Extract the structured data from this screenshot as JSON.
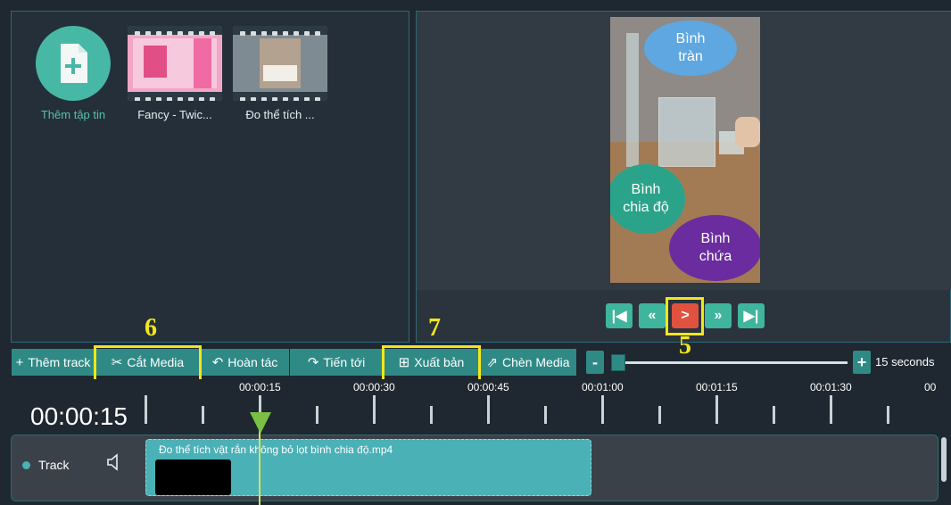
{
  "media": {
    "add_label": "Thêm tập tin",
    "items": [
      {
        "label": "Fancy - Twic..."
      },
      {
        "label": "Đo thể tích ..."
      }
    ]
  },
  "preview": {
    "bubbles": {
      "overflow": "Bình tràn",
      "graduated": "Bình chia độ",
      "container": "Bình chứa"
    }
  },
  "toolbar": {
    "add_track": "Thêm track",
    "cut_media": "Cắt Media",
    "undo": "Hoàn tác",
    "redo": "Tiến tới",
    "export": "Xuất bản",
    "insert_media": "Chèn Media",
    "zoom_minus": "-",
    "zoom_plus": "+",
    "zoom_value": "15 seconds"
  },
  "callouts": {
    "six": "6",
    "seven": "7",
    "five": "5"
  },
  "timeline": {
    "current_time": "00:00:15",
    "ticks": [
      "00:00:15",
      "00:00:30",
      "00:00:45",
      "00:01:00",
      "00:01:15",
      "00:01:30",
      "00"
    ],
    "track_label": "Track",
    "clip_title": "Đo thể tích vật rắn không bỏ lọt bình chia độ.mp4"
  },
  "colors": {
    "accent": "#2f8a86",
    "highlight": "#f2e61c",
    "play": "#e0523f"
  }
}
